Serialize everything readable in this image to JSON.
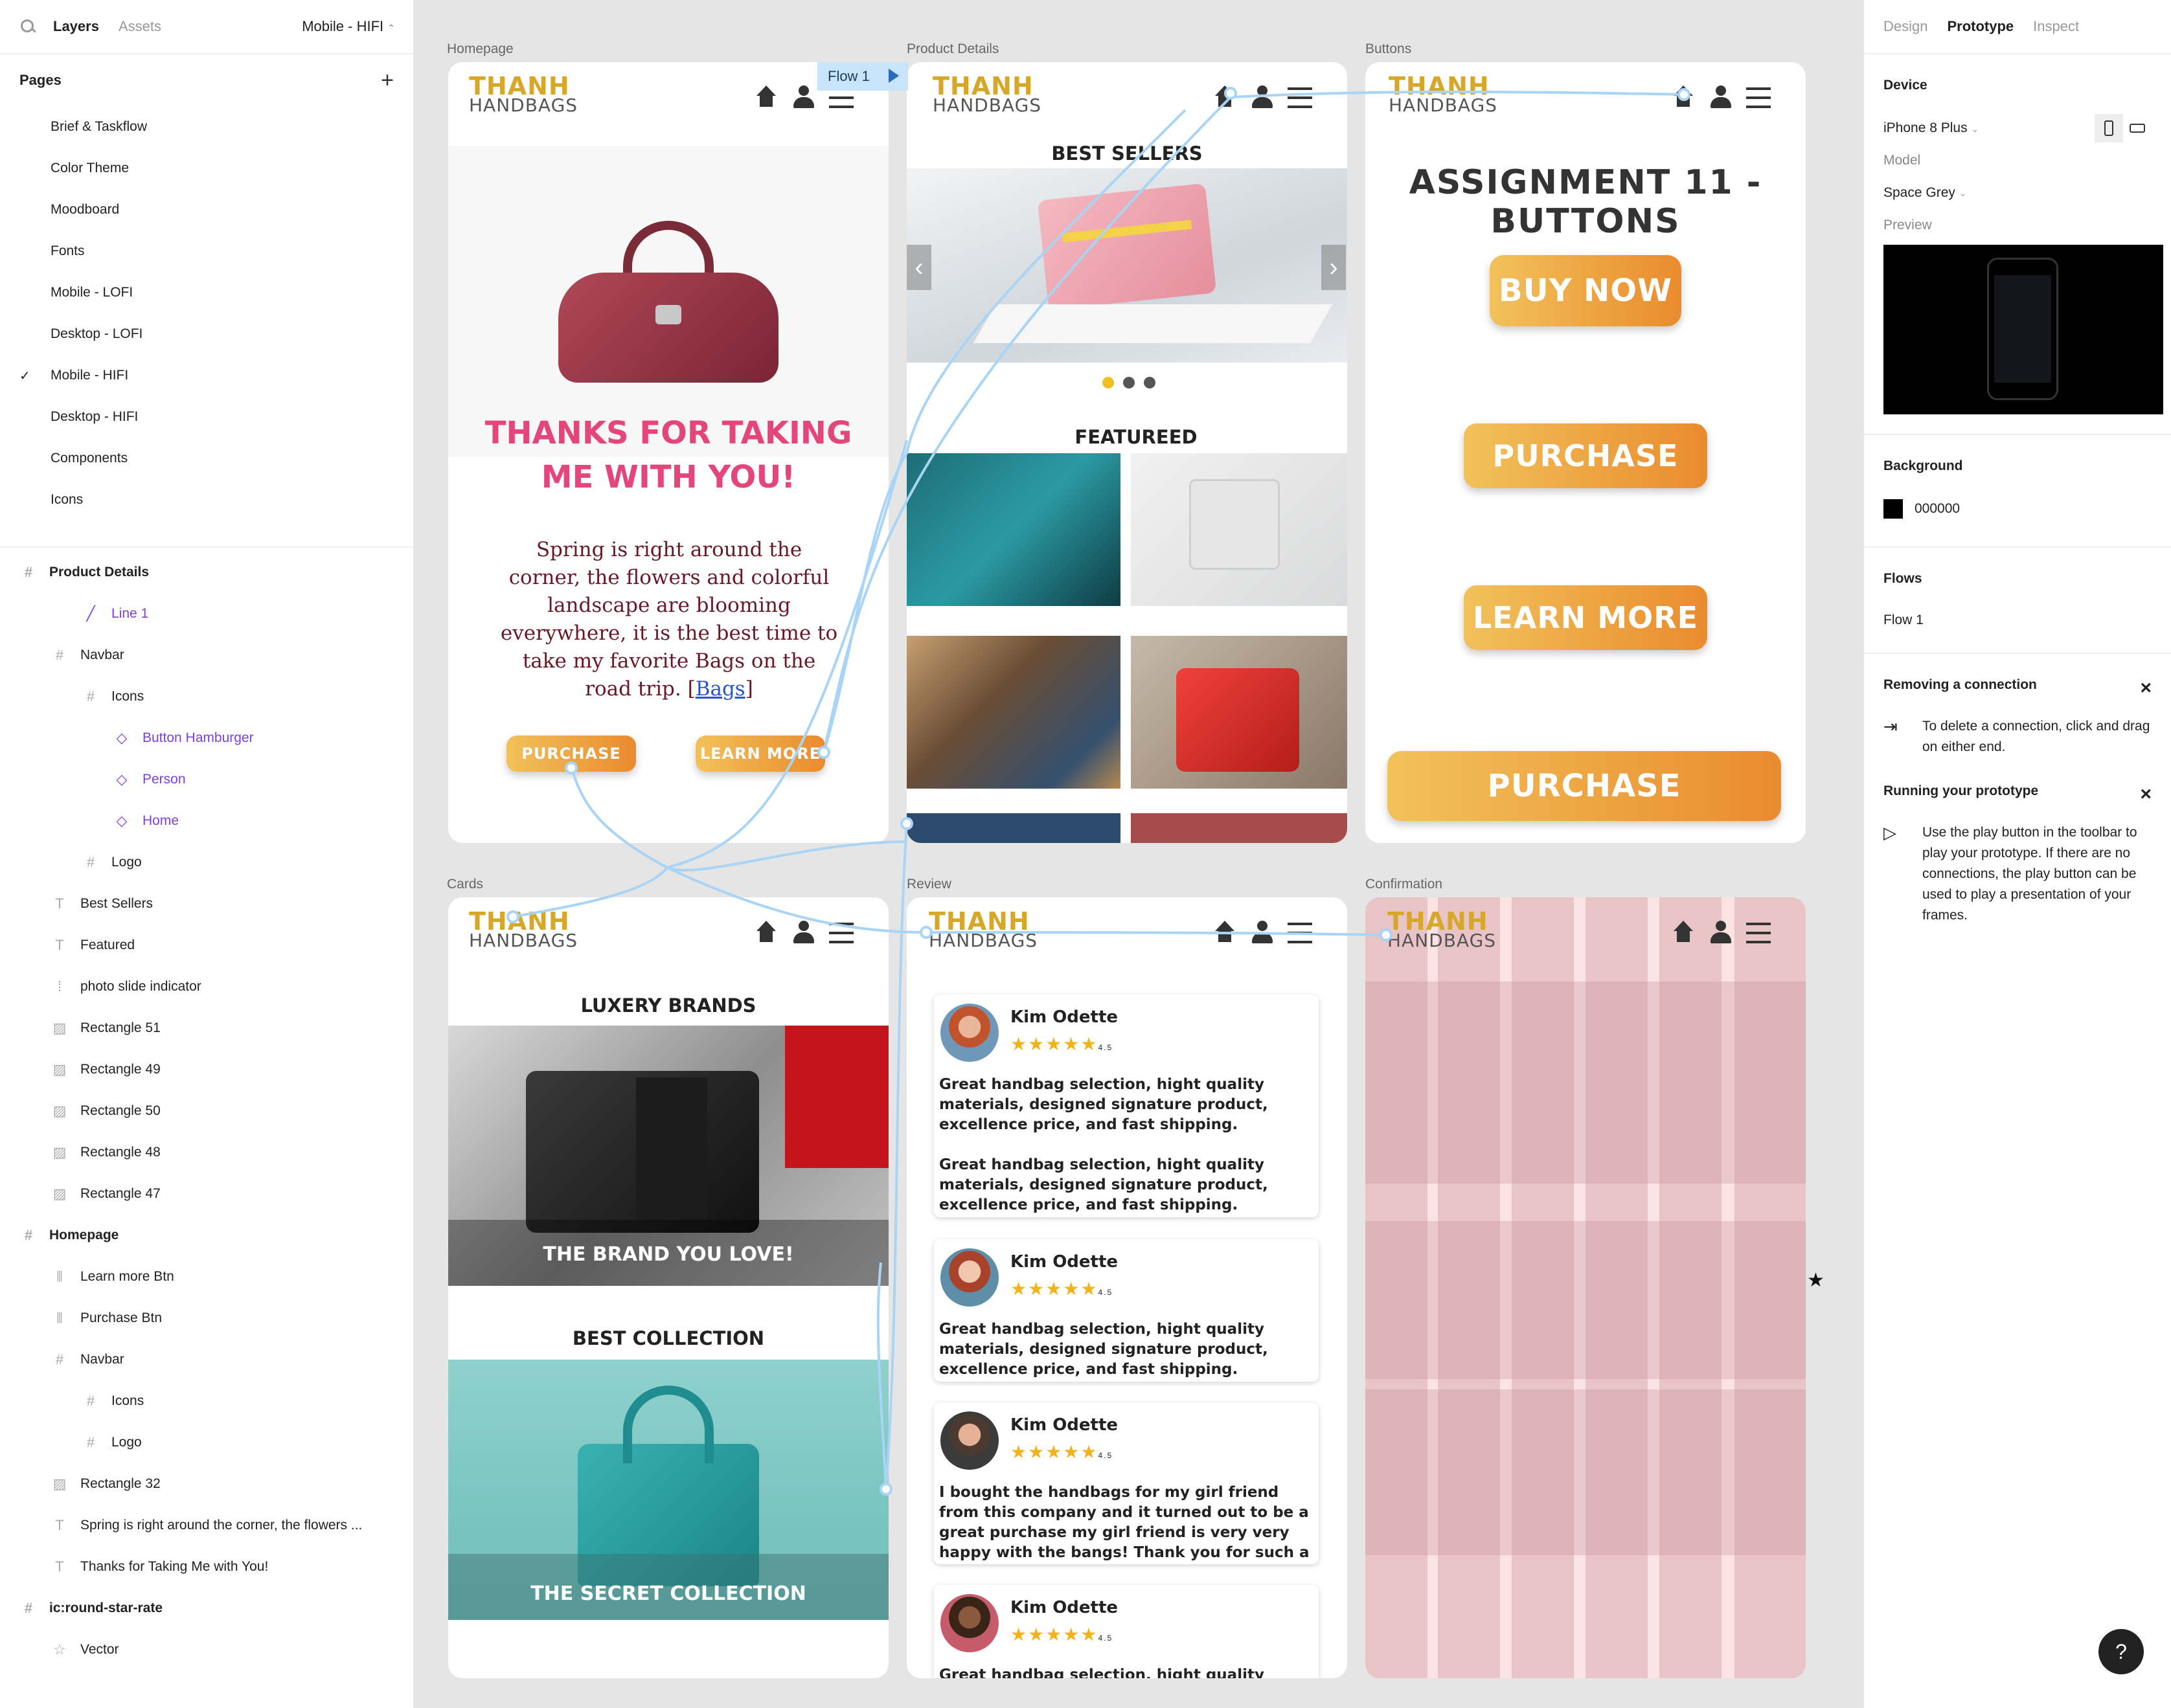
{
  "left_panel": {
    "tabs": [
      "Layers",
      "Assets"
    ],
    "current_page": "Mobile - HIFI",
    "pages_title": "Pages",
    "pages": [
      "Brief & Taskflow",
      "Color Theme",
      "Moodboard",
      "Fonts",
      "Mobile - LOFI",
      "Desktop - LOFI",
      "Mobile - HIFI",
      "Desktop - HIFI",
      "Components",
      "Icons"
    ],
    "layers": [
      {
        "label": "Product Details",
        "icon": "frame",
        "bold": true
      },
      {
        "label": "Line 1",
        "icon": "line",
        "purple": true
      },
      {
        "label": "Navbar",
        "icon": "frame"
      },
      {
        "label": "Icons",
        "icon": "frame"
      },
      {
        "label": "Button Hamburger",
        "icon": "component",
        "purple": true
      },
      {
        "label": "Person",
        "icon": "component",
        "purple": true
      },
      {
        "label": "Home",
        "icon": "component",
        "purple": true
      },
      {
        "label": "Logo",
        "icon": "frame"
      },
      {
        "label": "Best Sellers",
        "icon": "text"
      },
      {
        "label": "Featured",
        "icon": "text"
      },
      {
        "label": "photo slide indicator",
        "icon": "group"
      },
      {
        "label": "Rectangle 51",
        "icon": "image"
      },
      {
        "label": "Rectangle 49",
        "icon": "image"
      },
      {
        "label": "Rectangle 50",
        "icon": "image"
      },
      {
        "label": "Rectangle 48",
        "icon": "image"
      },
      {
        "label": "Rectangle 47",
        "icon": "image"
      },
      {
        "label": "Homepage",
        "icon": "frame",
        "bold": true
      },
      {
        "label": "Learn more Btn",
        "icon": "instance"
      },
      {
        "label": "Purchase Btn",
        "icon": "instance"
      },
      {
        "label": "Navbar",
        "icon": "frame"
      },
      {
        "label": "Icons",
        "icon": "frame"
      },
      {
        "label": "Logo",
        "icon": "frame"
      },
      {
        "label": "Rectangle 32",
        "icon": "image"
      },
      {
        "label": "Spring is right around the corner, the flowers ...",
        "icon": "text"
      },
      {
        "label": "Thanks for Taking Me with You!",
        "icon": "text"
      },
      {
        "label": "ic:round-star-rate",
        "icon": "frame",
        "bold": true
      },
      {
        "label": "Vector",
        "icon": "star"
      }
    ]
  },
  "right_panel": {
    "tabs": [
      "Design",
      "Prototype",
      "Inspect"
    ],
    "device_title": "Device",
    "device": "iPhone 8 Plus",
    "model_label": "Model",
    "model": "Space Grey",
    "preview_label": "Preview",
    "background_title": "Background",
    "background_value": "000000",
    "flows_title": "Flows",
    "flow": "Flow 1",
    "tip1_title": "Removing a connection",
    "tip1_text": "To delete a connection, click and drag on either end.",
    "tip2_title": "Running your prototype",
    "tip2_text": "Use the play button in the toolbar to play your prototype. If there are no connections, the play button can be used to play a presentation of your frames.",
    "help": "?"
  },
  "canvas": {
    "flow_tag": "Flow 1",
    "logo_line1": "THANH",
    "logo_line2": "HANDBAGS",
    "frames": {
      "homepage": {
        "label": "Homepage",
        "headline_1": "THANKS FOR TAKING",
        "headline_2": "ME WITH YOU!",
        "body_before_link": "Spring is right around the corner, the flowers and colorful landscape are blooming everywhere, it is the best time to take my favorite Bags on the road trip. [",
        "body_link": "Bags",
        "body_after_link": "]",
        "purchase_btn": "PURCHASE",
        "learn_btn": "LEARN MORE"
      },
      "product_details": {
        "label": "Product Details",
        "best_sellers": "BEST SELLERS",
        "featured": "FEATUREED",
        "arrow_left": "‹",
        "arrow_right": "›"
      },
      "buttons": {
        "label": "Buttons",
        "title": "ASSIGNMENT 11 - BUTTONS",
        "buy_now": "BUY NOW",
        "purchase": "PURCHASE",
        "learn_more": "LEARN MORE",
        "purchase_wide": "PURCHASE"
      },
      "cards": {
        "label": "Cards",
        "luxery": "LUXERY BRANDS",
        "card1_caption": "THE BRAND YOU LOVE!",
        "best_collection": "BEST COLLECTION",
        "card2_caption": "THE SECRET COLLECTION"
      },
      "review": {
        "label": "Review",
        "reviews": [
          {
            "name": "Kim Odette",
            "rating": "4.5",
            "text": "Great handbag selection, hight quality materials, designed signature product, excellence price, and fast shipping.\n\nGreat handbag selection, hight quality materials, designed signature product, excellence price, and fast shipping."
          },
          {
            "name": "Kim Odette",
            "rating": "4.5",
            "text": "Great handbag selection, hight quality materials, designed signature product, excellence price, and fast shipping."
          },
          {
            "name": "Kim Odette",
            "rating": "4.5",
            "text": "I bought the handbags for my girl friend from this company and it turned out to be a great purchase my girl friend is very very happy with the bangs! Thank you for such a good product and price!"
          },
          {
            "name": "Kim Odette",
            "rating": "4.5",
            "text": "Great handbag selection, hight quality materials"
          }
        ]
      },
      "confirmation": {
        "label": "Confirmation"
      }
    },
    "colors": {
      "brand_gold": "#d7a72a",
      "headline_pink": "#e4457a",
      "flow_line": "#a9d4f5",
      "button_gradient_start": "#f2c15a",
      "button_gradient_end": "#e98b2e"
    }
  }
}
